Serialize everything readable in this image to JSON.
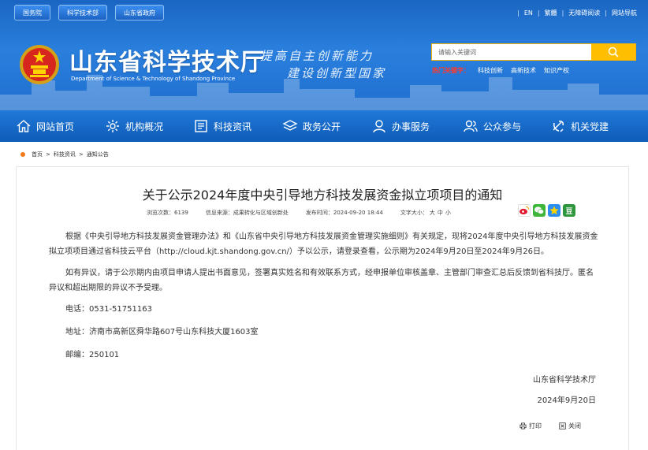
{
  "top_tabs": [
    "国务院",
    "科学技术部",
    "山东省政府"
  ],
  "top_links": [
    "EN",
    "繁體",
    "无障碍阅读",
    "网站导航"
  ],
  "site": {
    "title": "山东省科学技术厅",
    "subtitle": "Department of Science & Technology of Shandong Province",
    "slogan_line1": "提高自主创新能力",
    "slogan_line2": "建设创新型国家"
  },
  "search": {
    "placeholder": "请输入关键词",
    "hot_label": "热门关键字：",
    "hot_words": [
      "科技创新",
      "高新技术",
      "知识产权"
    ]
  },
  "nav": [
    {
      "label": "网站首页",
      "icon": "home-icon"
    },
    {
      "label": "机构概况",
      "icon": "gear-icon"
    },
    {
      "label": "科技资讯",
      "icon": "news-icon"
    },
    {
      "label": "政务公开",
      "icon": "layers-icon"
    },
    {
      "label": "办事服务",
      "icon": "service-icon"
    },
    {
      "label": "公众参与",
      "icon": "people-icon"
    },
    {
      "label": "机关党建",
      "icon": "party-emblem-icon"
    }
  ],
  "breadcrumb": [
    "首页",
    "科技资讯",
    "通知公告"
  ],
  "breadcrumb_sep": ">",
  "article": {
    "title": "关于公示2024年度中央引导地方科技发展资金拟立项项目的通知",
    "views_label": "浏览次数：",
    "views": "6139",
    "source_label": "信息来源：",
    "source": "成果转化与区域创新处",
    "date_label": "发布时间：",
    "date": "2024-09-20 18:44",
    "fontsize_label": "文字大小：",
    "fontsize_options": [
      "大",
      "中",
      "小"
    ],
    "paragraphs": [
      "根据《中央引导地方科技发展资金管理办法》和《山东省中央引导地方科技发展资金管理实施细则》有关规定，现将2024年度中央引导地方科技发展资金拟立项项目通过省科技云平台（http://cloud.kjt.shandong.gov.cn/）予以公示，请登录查看，公示期为2024年9月20日至2024年9月26日。",
      "如有异议，请于公示期内由项目申请人提出书面意见，签署真实姓名和有效联系方式，经申报单位审核盖章、主管部门审查汇总后反馈到省科技厅。匿名异议和超出期限的异议不予受理。"
    ],
    "phone": "电话：0531-51751163",
    "address": "地址：济南市高新区舜华路607号山东科技大厦1603室",
    "postcode": "邮编：250101",
    "sign_org": "山东省科学技术厅",
    "sign_date": "2024年9月20日"
  },
  "share_icons": [
    "weibo-icon",
    "wechat-icon",
    "qzone-icon",
    "douban-icon"
  ],
  "share_douban_glyph": "豆",
  "actions": {
    "print": "打印",
    "close": "关闭"
  },
  "colors": {
    "primary": "#1f6fcf",
    "accent": "#ffbf00",
    "hot": "#ff3b2f",
    "bullet": "#f07a1a"
  }
}
